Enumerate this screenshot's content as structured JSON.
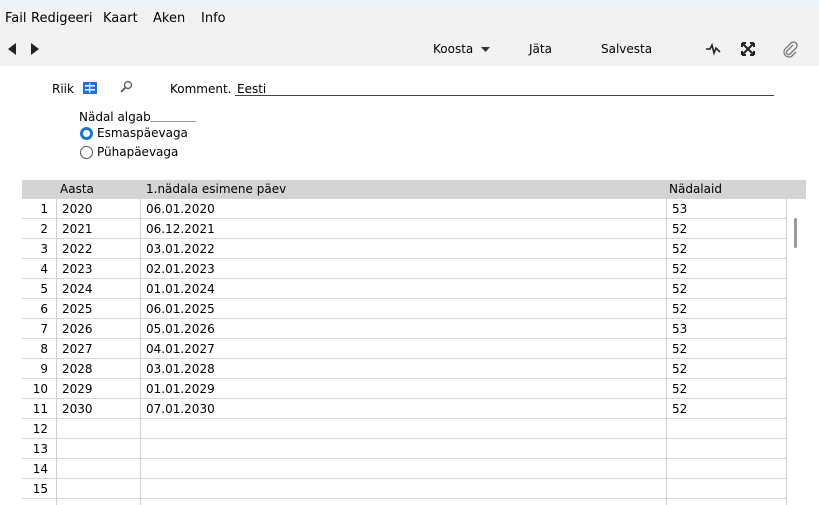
{
  "menu": [
    {
      "label": "Fail"
    },
    {
      "label": "Redigeeri"
    },
    {
      "label": "Kaart"
    },
    {
      "label": "Aken"
    },
    {
      "label": "Info"
    }
  ],
  "toolbar": {
    "koosta_label": "Koosta",
    "jata_label": "Jäta",
    "salvesta_label": "Salvesta"
  },
  "form": {
    "riik_label": "Riik",
    "komment_label": "Komment.",
    "komment_value": "Eesti",
    "week_starts_label": "Nädal algab",
    "options": [
      {
        "label": "Esmaspäevaga",
        "selected": true
      },
      {
        "label": "Pühapäevaga",
        "selected": false
      }
    ]
  },
  "grid": {
    "headers": {
      "year": "Aasta",
      "first_day": "1.nädala esimene päev",
      "weeks": "Nädalaid"
    },
    "rows": [
      {
        "n": "1",
        "year": "2020",
        "first_day": "06.01.2020",
        "weeks": "53"
      },
      {
        "n": "2",
        "year": "2021",
        "first_day": "06.12.2021",
        "weeks": "52"
      },
      {
        "n": "3",
        "year": "2022",
        "first_day": "03.01.2022",
        "weeks": "52"
      },
      {
        "n": "4",
        "year": "2023",
        "first_day": "02.01.2023",
        "weeks": "52"
      },
      {
        "n": "5",
        "year": "2024",
        "first_day": "01.01.2024",
        "weeks": "52"
      },
      {
        "n": "6",
        "year": "2025",
        "first_day": "06.01.2025",
        "weeks": "52"
      },
      {
        "n": "7",
        "year": "2026",
        "first_day": "05.01.2026",
        "weeks": "53"
      },
      {
        "n": "8",
        "year": "2027",
        "first_day": "04.01.2027",
        "weeks": "52"
      },
      {
        "n": "9",
        "year": "2028",
        "first_day": "03.01.2028",
        "weeks": "52"
      },
      {
        "n": "10",
        "year": "2029",
        "first_day": "01.01.2029",
        "weeks": "52"
      },
      {
        "n": "11",
        "year": "2030",
        "first_day": "07.01.2030",
        "weeks": "52"
      },
      {
        "n": "12",
        "year": "",
        "first_day": "",
        "weeks": ""
      },
      {
        "n": "13",
        "year": "",
        "first_day": "",
        "weeks": ""
      },
      {
        "n": "14",
        "year": "",
        "first_day": "",
        "weeks": ""
      },
      {
        "n": "15",
        "year": "",
        "first_day": "",
        "weeks": ""
      }
    ]
  },
  "colors": {
    "accent": "#1a73d9",
    "header_bg": "#d4d4d4",
    "bar_bg": "#f2f2f2"
  }
}
